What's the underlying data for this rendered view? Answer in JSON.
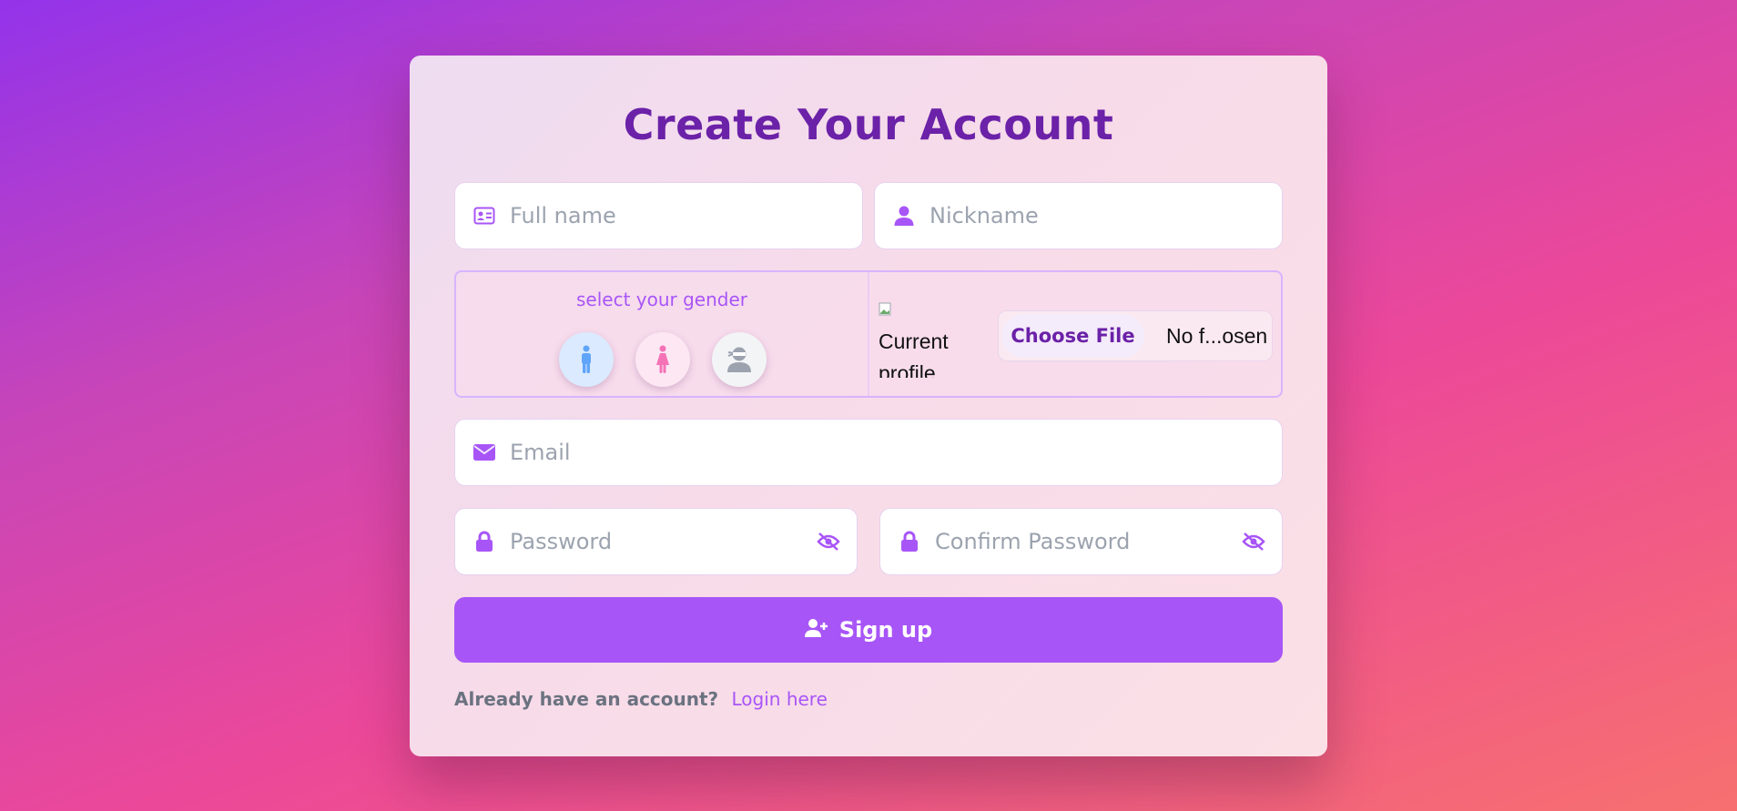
{
  "form": {
    "title": "Create Your Account",
    "full_name": {
      "placeholder": "Full name",
      "icon": "id-card-icon"
    },
    "nickname": {
      "placeholder": "Nickname",
      "icon": "user-icon"
    },
    "gender": {
      "label": "select your gender",
      "options": [
        {
          "name": "male",
          "icon": "male-icon",
          "bg": "#dbeafe",
          "color": "#60a5fa"
        },
        {
          "name": "female",
          "icon": "female-icon",
          "bg": "#fce7f3",
          "color": "#f472b6"
        },
        {
          "name": "other",
          "icon": "user-ninja-icon",
          "bg": "#f3f4f6",
          "color": "#9ca3af"
        }
      ]
    },
    "profile": {
      "image_alt": "Current profile",
      "choose_label": "Choose File",
      "file_status": "No f...osen"
    },
    "email": {
      "placeholder": "Email",
      "icon": "envelope-icon"
    },
    "password": {
      "placeholder": "Password",
      "icon": "lock-icon",
      "toggle_icon": "eye-slash-icon"
    },
    "confirm_password": {
      "placeholder": "Confirm Password",
      "icon": "lock-icon",
      "toggle_icon": "eye-slash-icon"
    },
    "submit_label": "Sign up",
    "footer": {
      "question": "Already have an account?",
      "login_link": "Login here"
    }
  },
  "colors": {
    "accent": "#a855f7",
    "title": "#6b21a8",
    "placeholder": "#9ca3af"
  }
}
